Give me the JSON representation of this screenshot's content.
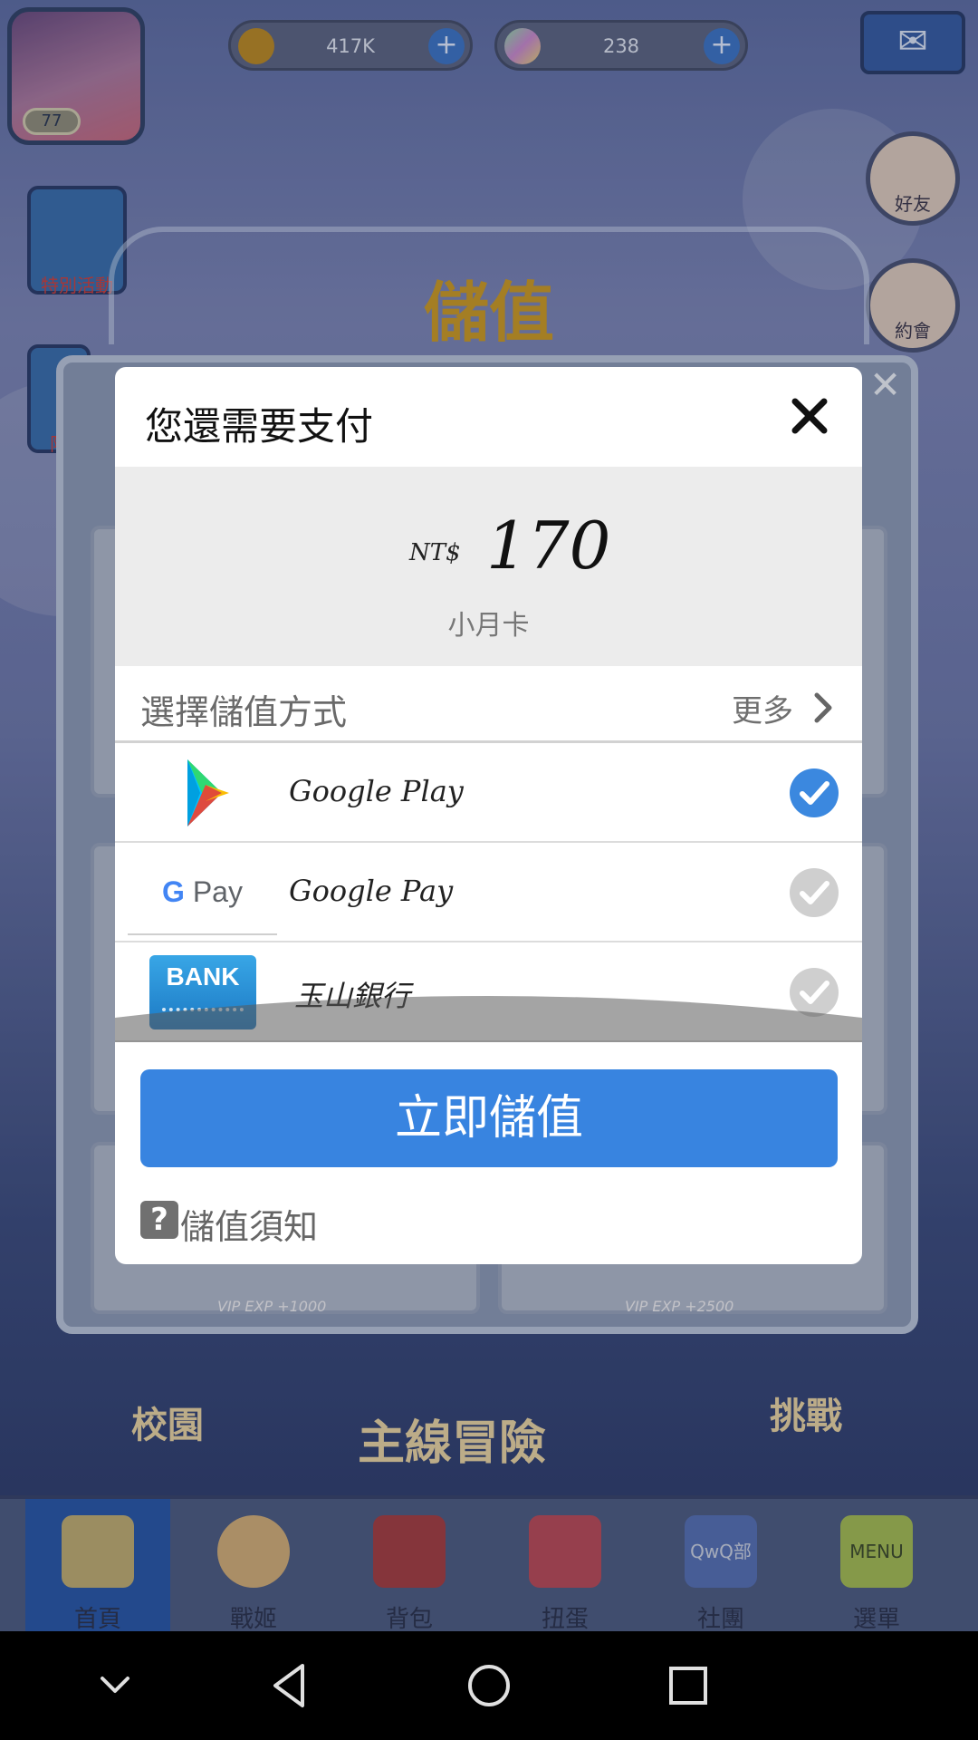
{
  "game": {
    "player_level": "77",
    "coins": "417K",
    "gems": "238",
    "shop_title": "儲值",
    "side_buttons": [
      "好友",
      "約會"
    ],
    "left_buttons": [
      "特別活動",
      "限"
    ],
    "vip_labels": [
      "VIP EXP +1000",
      "VIP EXP +2500"
    ],
    "area_labels": [
      "校園",
      "主線冒險",
      "挑戰"
    ],
    "tabs": [
      "首頁",
      "戰姬",
      "背包",
      "扭蛋",
      "社團",
      "選單"
    ],
    "tab_deco": [
      "",
      "",
      "",
      "",
      "QwQ部",
      "MENU"
    ]
  },
  "dialog": {
    "title": "您還需要支付",
    "currency": "NT$",
    "amount": "170",
    "item_name": "小月卡",
    "method_label": "選擇儲值方式",
    "more_label": "更多",
    "methods": [
      {
        "name": "Google Play",
        "selected": true,
        "icon": "google-play-icon"
      },
      {
        "name": "Google Pay",
        "selected": false,
        "icon": "google-pay-logo",
        "logo_text": "G Pay"
      },
      {
        "name": "玉山銀行",
        "selected": false,
        "icon": "bank-icon",
        "logo_text": "BANK"
      }
    ],
    "pay_button": "立即儲值",
    "notice_icon": "?",
    "notice_label": "儲值須知"
  },
  "colors": {
    "accent_blue": "#3884e0",
    "check_selected": "#3b88df",
    "check_unselected": "#cfcfcf"
  }
}
